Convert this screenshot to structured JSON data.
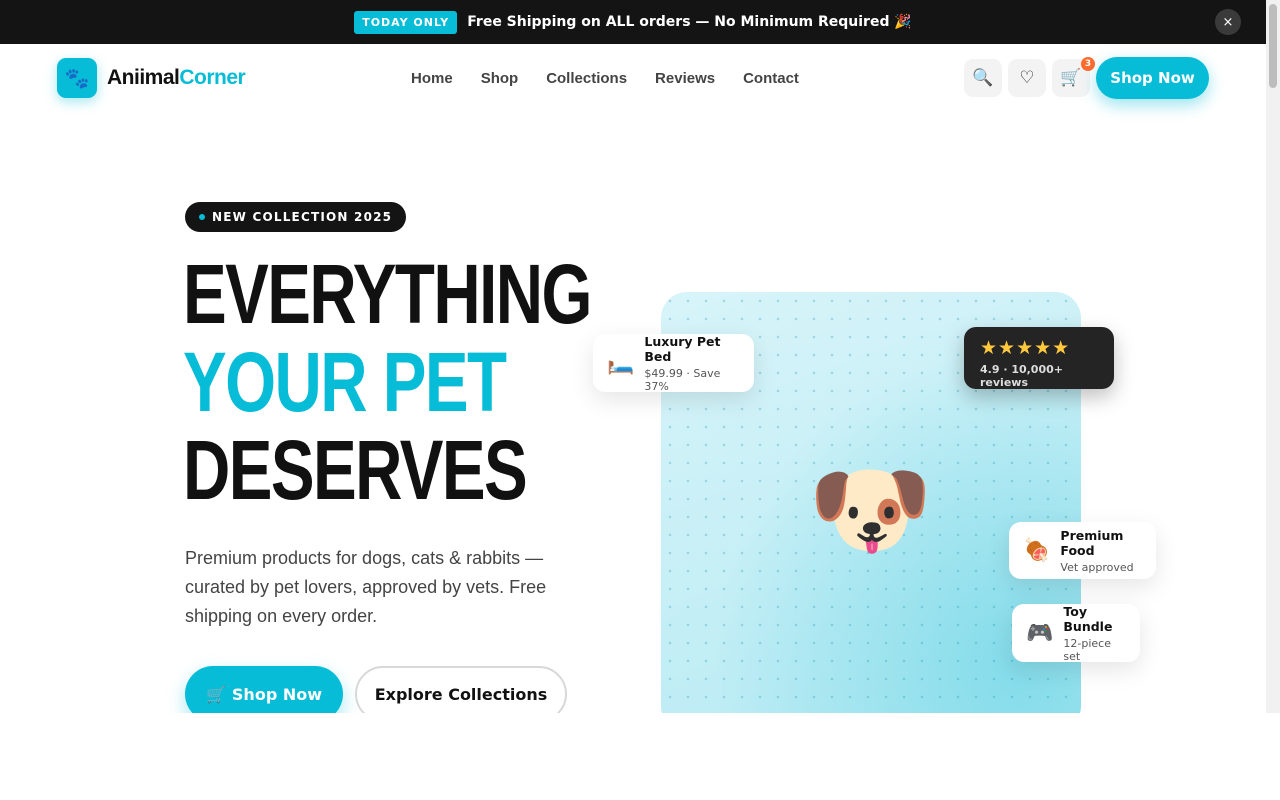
{
  "announcement": {
    "badge": "TODAY ONLY",
    "message": "Free Shipping on ALL orders — No Minimum Required 🎉",
    "close_icon": "×"
  },
  "header": {
    "logo_icon": "🐾",
    "logo_part1": "Aniimal",
    "logo_part2": "Corner",
    "nav": [
      "Home",
      "Shop",
      "Collections",
      "Reviews",
      "Contact"
    ],
    "search_icon": "🔍",
    "wishlist_icon": "♡",
    "cart_icon": "🛒",
    "cart_count": "3",
    "shop_button": "Shop Now"
  },
  "hero": {
    "pill": "NEW COLLECTION 2025",
    "headline_line1": "EVERYTHING",
    "headline_line2": "YOUR PET",
    "headline_line3": "DESERVES",
    "subtitle": "Premium products for dogs, cats & rabbits — curated by pet lovers, approved by vets. Free shipping on every order.",
    "cta_primary_icon": "🛒",
    "cta_primary": "Shop Now",
    "cta_secondary": "Explore Collections"
  },
  "showcase": {
    "hero_image": "🐶",
    "rating_stars": "★★★★★",
    "rating_text": "4.9 · 10,000+ reviews",
    "cards": [
      {
        "icon": "🛏️",
        "title": "Luxury Pet Bed",
        "subtitle": "$49.99 · Save 37%"
      },
      {
        "icon": "🍖",
        "title": "Premium Food",
        "subtitle": "Vet approved"
      },
      {
        "icon": "🎮",
        "title": "Toy Bundle",
        "subtitle": "12-piece set"
      }
    ]
  },
  "colors": {
    "accent": "#06bcd6",
    "dark": "#141414",
    "badge_orange": "#ff6b2c"
  }
}
